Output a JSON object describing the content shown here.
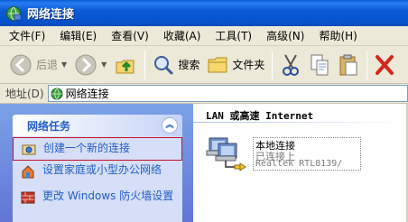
{
  "window": {
    "title": "网络连接"
  },
  "menu": {
    "items": [
      "文件(F)",
      "编辑(E)",
      "查看(V)",
      "收藏(A)",
      "工具(T)",
      "高级(N)",
      "帮助(H)"
    ]
  },
  "toolbar": {
    "back_label": "后退",
    "search_label": "搜索",
    "folders_label": "文件夹"
  },
  "address": {
    "label": "地址(D)",
    "value": "网络连接"
  },
  "tasks": {
    "header": "网络任务",
    "items": [
      {
        "label": "创建一个新的连接",
        "icon": "new-connection-icon",
        "selected": true
      },
      {
        "label": "设置家庭或小型办公网络",
        "icon": "home-network-icon",
        "selected": false
      },
      {
        "label": "更改 Windows 防火墙设置",
        "icon": "firewall-icon",
        "selected": false
      }
    ]
  },
  "content": {
    "group_title": "LAN 或高速 Internet",
    "connection": {
      "name": "本地连接",
      "status": "已连接上",
      "device": "Realtek RTL8139/"
    }
  },
  "colors": {
    "titlebar": "#0a5fd8",
    "task_link": "#215dc6",
    "selection_border": "#c8102e"
  }
}
